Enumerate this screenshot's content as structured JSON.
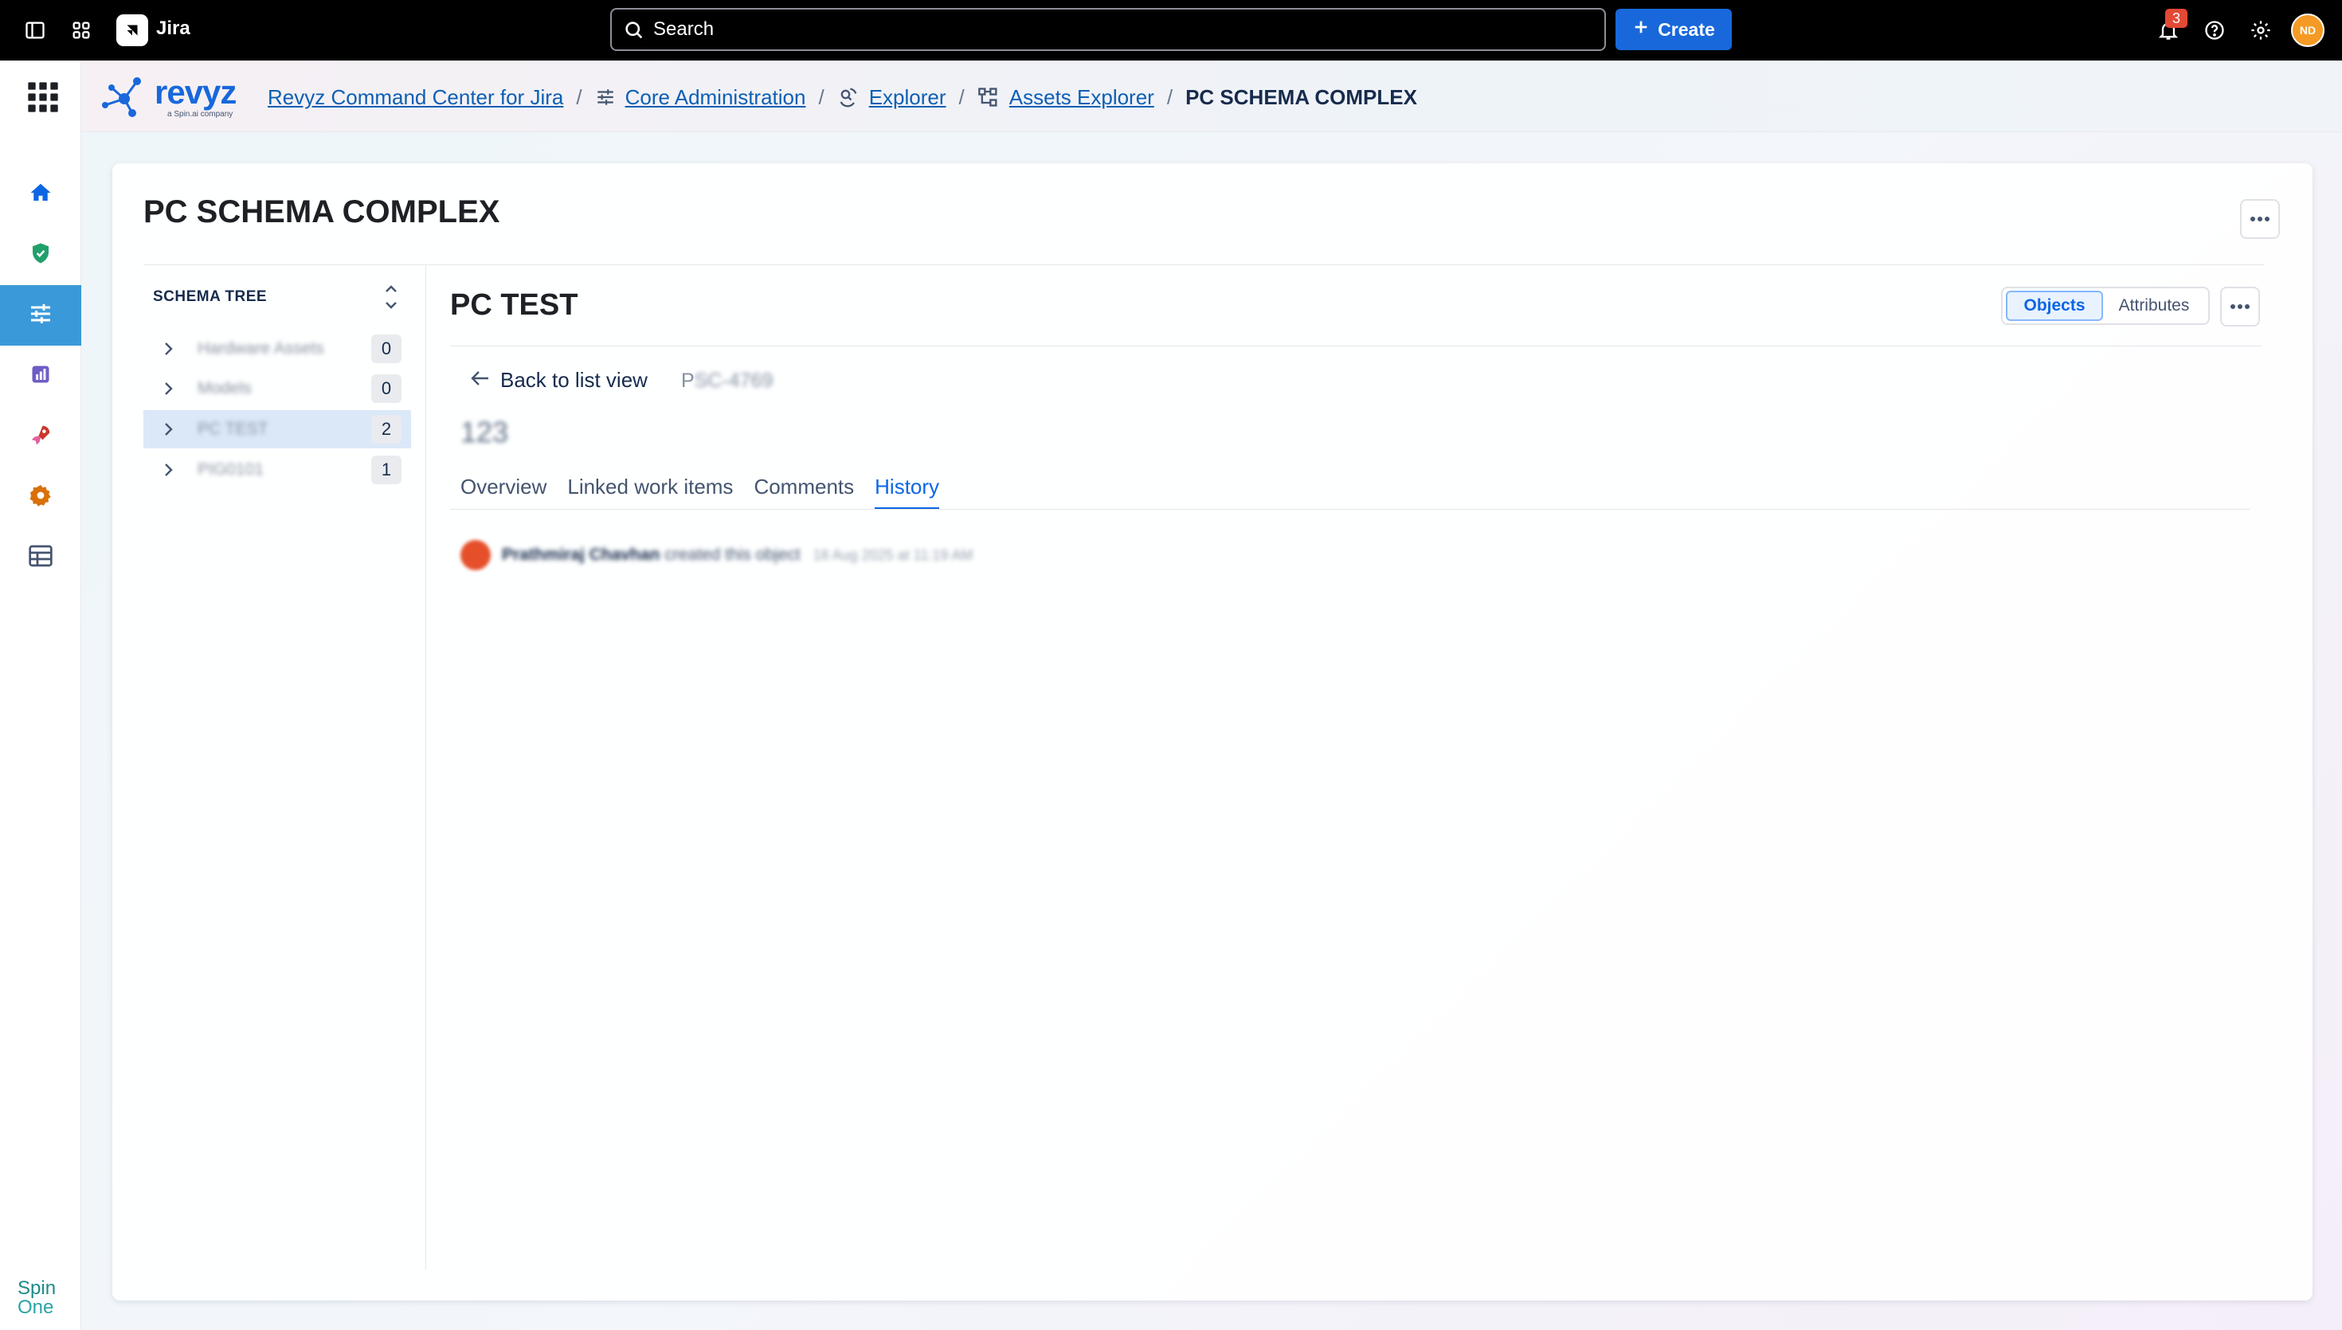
{
  "topbar": {
    "app_name": "Jira",
    "search_placeholder": "Search",
    "create_label": "Create",
    "notification_count": "3",
    "user_initials": "ND"
  },
  "rail": {
    "items": [
      {
        "icon": "home-icon",
        "active": false
      },
      {
        "icon": "shield-check-icon",
        "active": false
      },
      {
        "icon": "sliders-icon",
        "active": true
      },
      {
        "icon": "report-icon",
        "active": false
      },
      {
        "icon": "rocket-icon",
        "active": false
      },
      {
        "icon": "gear-icon",
        "active": false
      },
      {
        "icon": "table-icon",
        "active": false
      }
    ],
    "footer_brand_line1": "Spin",
    "footer_brand_line2": "One"
  },
  "breadcrumbs": {
    "brand": "revyz",
    "brand_tagline": "a Spin.ai company",
    "items": [
      {
        "label": "Revyz Command Center for Jira",
        "icon": null
      },
      {
        "label": "Core Administration",
        "icon": "sliders-icon"
      },
      {
        "label": "Explorer",
        "icon": "explorer-icon"
      },
      {
        "label": "Assets Explorer",
        "icon": "hierarchy-icon"
      }
    ],
    "current": "PC SCHEMA COMPLEX",
    "separator": "/"
  },
  "page": {
    "title": "PC SCHEMA COMPLEX"
  },
  "schema_tree": {
    "header": "SCHEMA TREE",
    "rows": [
      {
        "label": "Hardware Assets",
        "count": "0",
        "selected": false
      },
      {
        "label": "Models",
        "count": "0",
        "selected": false
      },
      {
        "label": "PC TEST",
        "count": "2",
        "selected": true
      },
      {
        "label": "PIG0101",
        "count": "1",
        "selected": false
      }
    ]
  },
  "object_panel": {
    "title": "PC TEST",
    "view_toggle": {
      "objects": "Objects",
      "attributes": "Attributes"
    },
    "back_label": "Back to list view",
    "object_key_visible": "P",
    "object_key_hidden": "SC-4769",
    "object_name": "123",
    "tabs": [
      "Overview",
      "Linked work items",
      "Comments",
      "History"
    ],
    "active_tab": "History",
    "history": [
      {
        "user": "Prathmiraj Chavhan",
        "action": "created this object",
        "timestamp": "18 Aug 2025 at 11:19 AM"
      }
    ]
  },
  "colors": {
    "topbar_bg": "#000000",
    "primary": "#1868db",
    "rail_active": "#3a9ad9",
    "link": "#0c5fb5",
    "tab_active": "#0c66e4",
    "avatar": "#f59a24",
    "badge": "#e34935"
  }
}
